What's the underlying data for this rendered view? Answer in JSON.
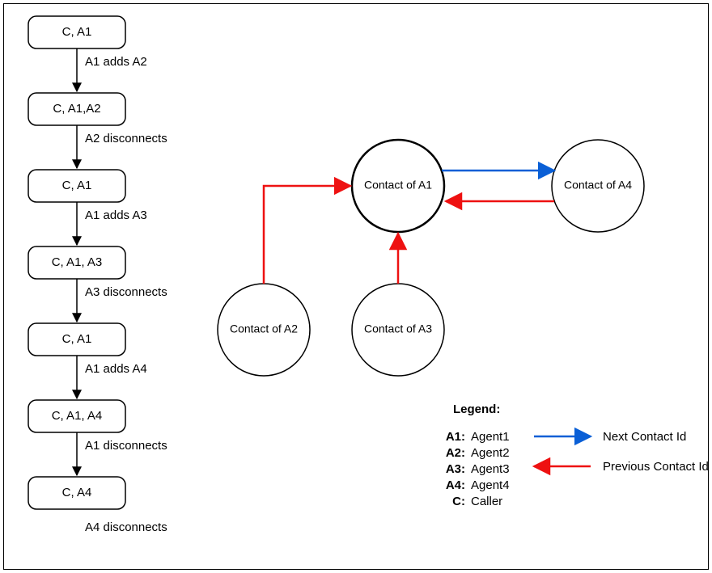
{
  "flow": {
    "boxes": [
      {
        "id": "b1",
        "label": "C, A1"
      },
      {
        "id": "b2",
        "label": "C, A1,A2"
      },
      {
        "id": "b3",
        "label": "C, A1"
      },
      {
        "id": "b4",
        "label": "C, A1, A3"
      },
      {
        "id": "b5",
        "label": "C, A1"
      },
      {
        "id": "b6",
        "label": "C, A1, A4"
      },
      {
        "id": "b7",
        "label": "C, A4"
      }
    ],
    "edges": [
      {
        "label": "A1 adds A2"
      },
      {
        "label": "A2 disconnects"
      },
      {
        "label": "A1 adds A3"
      },
      {
        "label": "A3 disconnects"
      },
      {
        "label": "A1 adds A4"
      },
      {
        "label": "A1 disconnects"
      },
      {
        "label": "A4 disconnects"
      }
    ]
  },
  "contacts": {
    "a1": "Contact of A1",
    "a2": "Contact of A2",
    "a3": "Contact of A3",
    "a4": "Contact of A4"
  },
  "legend": {
    "title": "Legend:",
    "items": [
      {
        "key": "A1:",
        "value": "Agent1"
      },
      {
        "key": "A2:",
        "value": "Agent2"
      },
      {
        "key": "A3:",
        "value": "Agent3"
      },
      {
        "key": "A4:",
        "value": "Agent4"
      },
      {
        "key": "C:",
        "value": "Caller"
      }
    ],
    "next": "Next Contact Id",
    "prev": "Previous Contact Id"
  }
}
